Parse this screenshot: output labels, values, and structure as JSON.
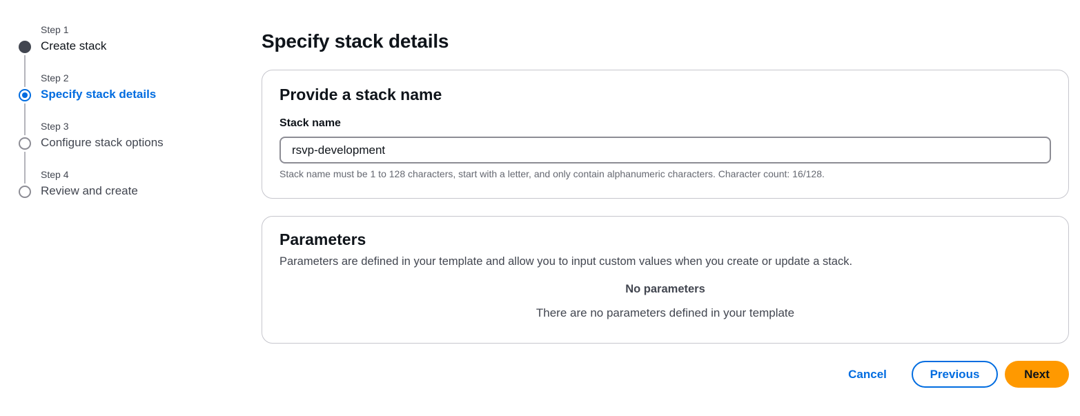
{
  "wizard": {
    "steps": [
      {
        "number": "Step 1",
        "title": "Create stack",
        "state": "done"
      },
      {
        "number": "Step 2",
        "title": "Specify stack details",
        "state": "active"
      },
      {
        "number": "Step 3",
        "title": "Configure stack options",
        "state": "pending"
      },
      {
        "number": "Step 4",
        "title": "Review and create",
        "state": "pending"
      }
    ]
  },
  "page": {
    "title": "Specify stack details"
  },
  "stack_name_panel": {
    "heading": "Provide a stack name",
    "field_label": "Stack name",
    "value": "rsvp-development",
    "constraint_text": "Stack name must be 1 to 128 characters, start with a letter, and only contain alphanumeric characters. Character count: 16/128."
  },
  "parameters_panel": {
    "heading": "Parameters",
    "description": "Parameters are defined in your template and allow you to input custom values when you create or update a stack.",
    "empty_title": "No parameters",
    "empty_description": "There are no parameters defined in your template"
  },
  "actions": {
    "cancel": "Cancel",
    "previous": "Previous",
    "next": "Next"
  },
  "colors": {
    "accent": "#006ce0",
    "primary_button": "#ff9900"
  }
}
